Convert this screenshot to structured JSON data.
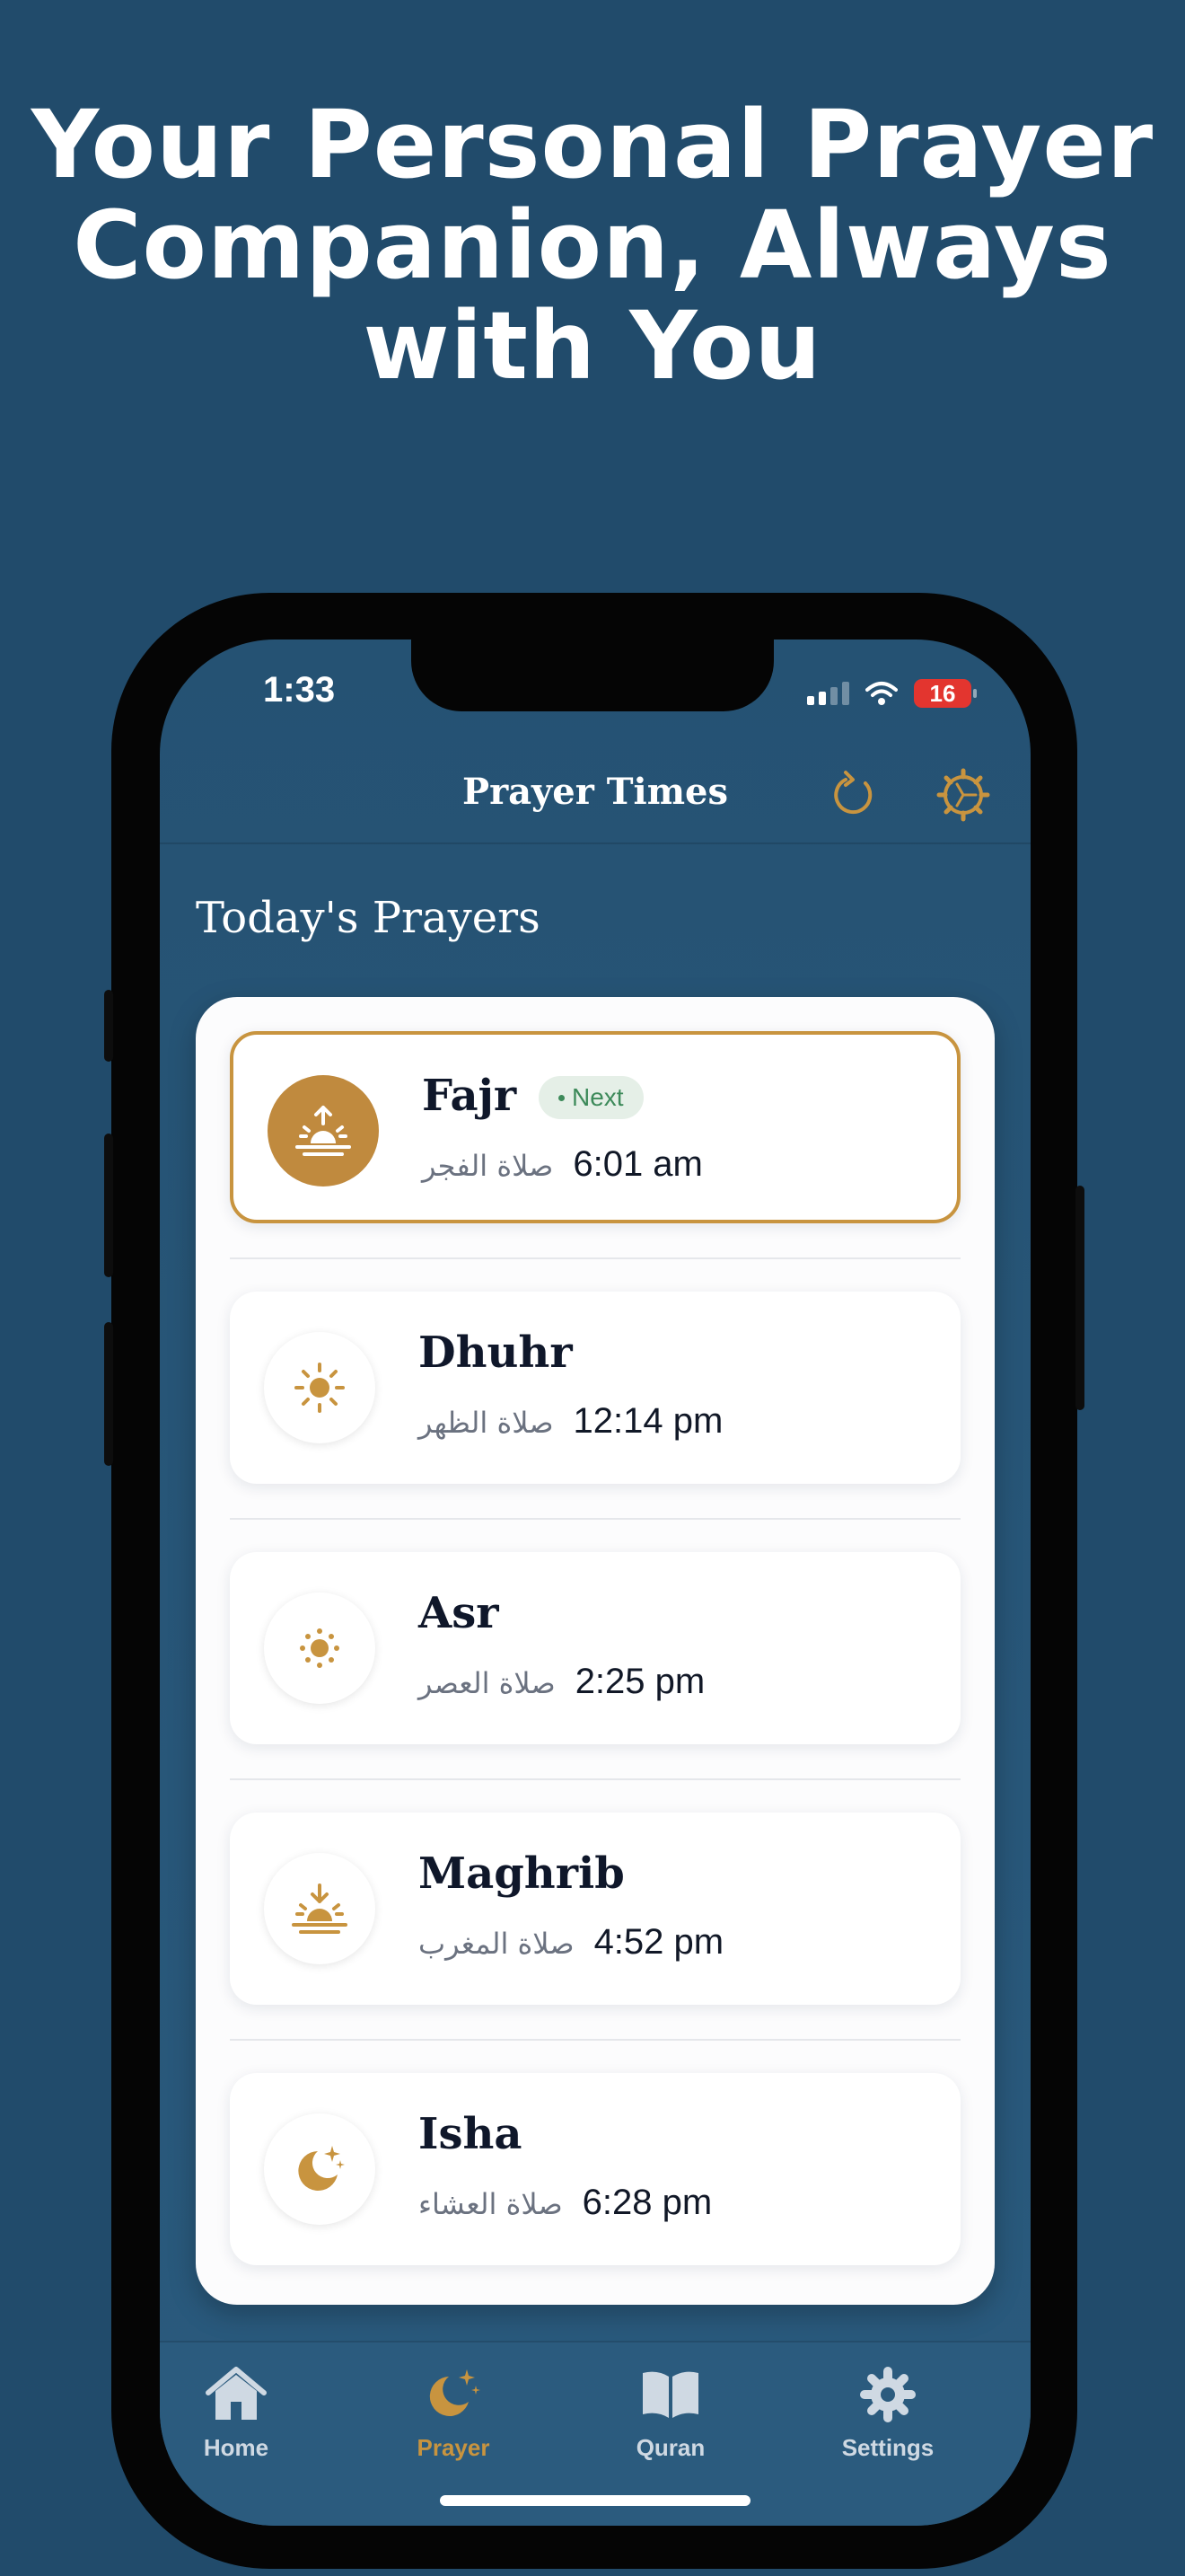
{
  "hero": {
    "line1": "Your Personal Prayer",
    "line2": "Companion, Always",
    "line3": "with You"
  },
  "status_bar": {
    "time": "1:33",
    "battery": "16"
  },
  "header": {
    "title": "Prayer Times",
    "refresh_icon": "refresh-icon",
    "settings_icon": "gear-icon"
  },
  "section_title": "Today's Prayers",
  "prayers": [
    {
      "name": "Fajr",
      "arabic": "صلاة الفجر",
      "time": "6:01 am",
      "badge": "Next",
      "icon": "sunrise-icon"
    },
    {
      "name": "Dhuhr",
      "arabic": "صلاة الظهر",
      "time": "12:14 pm",
      "icon": "sun-icon"
    },
    {
      "name": "Asr",
      "arabic": "صلاة العصر",
      "time": "2:25 pm",
      "icon": "small-sun-icon"
    },
    {
      "name": "Maghrib",
      "arabic": "صلاة المغرب",
      "time": "4:52 pm",
      "icon": "sunset-icon"
    },
    {
      "name": "Isha",
      "arabic": "صلاة العشاء",
      "time": "6:28 pm",
      "icon": "crescent-moon-icon"
    }
  ],
  "tabs": [
    {
      "label": "Home",
      "icon": "house-icon"
    },
    {
      "label": "Prayer",
      "icon": "crescent-moon-star-icon",
      "active": true
    },
    {
      "label": "Quran",
      "icon": "open-book-icon"
    },
    {
      "label": "Settings",
      "icon": "gear-icon"
    }
  ],
  "colors": {
    "background": "#214b6b",
    "accent": "#c8943f",
    "next_badge_bg": "#e5efe7",
    "next_badge_text": "#3d8a5a"
  }
}
